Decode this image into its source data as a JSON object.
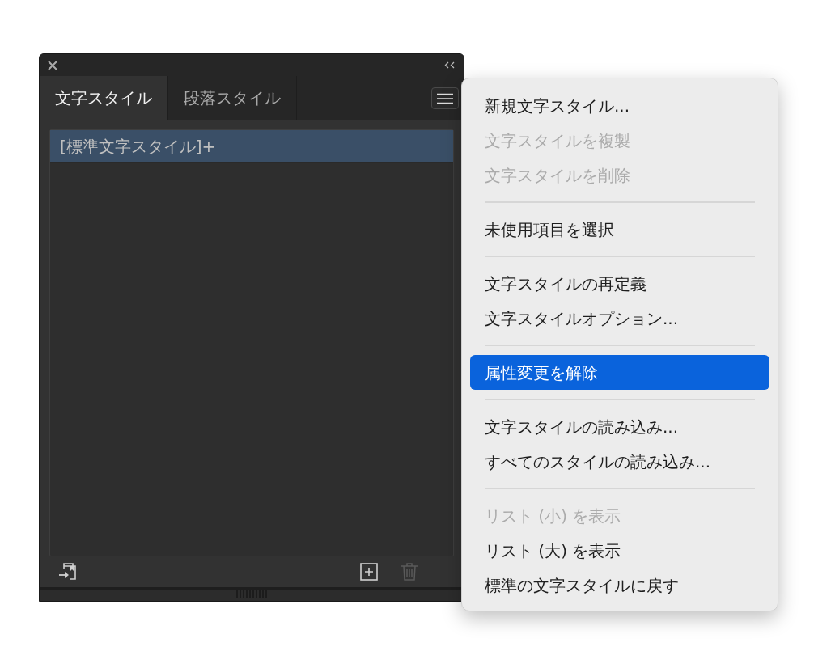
{
  "panel": {
    "tabs": [
      {
        "label": "文字スタイル",
        "selected": true
      },
      {
        "label": "段落スタイル",
        "selected": false
      }
    ],
    "styles": [
      {
        "label": "[標準文字スタイル]+",
        "selected": true
      }
    ],
    "footer_buttons": [
      {
        "kind": "load",
        "disabled": false
      },
      {
        "kind": "new",
        "disabled": false
      },
      {
        "kind": "delete",
        "disabled": true
      }
    ]
  },
  "menu": {
    "items": [
      {
        "kind": "item",
        "label": "新規文字スタイル...",
        "disabled": false,
        "selected": false
      },
      {
        "kind": "item",
        "label": "文字スタイルを複製",
        "disabled": true,
        "selected": false
      },
      {
        "kind": "item",
        "label": "文字スタイルを削除",
        "disabled": true,
        "selected": false
      },
      {
        "kind": "separator"
      },
      {
        "kind": "item",
        "label": "未使用項目を選択",
        "disabled": false,
        "selected": false
      },
      {
        "kind": "separator"
      },
      {
        "kind": "item",
        "label": "文字スタイルの再定義",
        "disabled": false,
        "selected": false
      },
      {
        "kind": "item",
        "label": "文字スタイルオプション...",
        "disabled": false,
        "selected": false
      },
      {
        "kind": "separator"
      },
      {
        "kind": "item",
        "label": "属性変更を解除",
        "disabled": false,
        "selected": true
      },
      {
        "kind": "separator"
      },
      {
        "kind": "item",
        "label": "文字スタイルの読み込み...",
        "disabled": false,
        "selected": false
      },
      {
        "kind": "item",
        "label": "すべてのスタイルの読み込み...",
        "disabled": false,
        "selected": false
      },
      {
        "kind": "separator"
      },
      {
        "kind": "item",
        "label": "リスト (小) を表示",
        "disabled": true,
        "selected": false
      },
      {
        "kind": "item",
        "label": "リスト (大) を表示",
        "disabled": false,
        "selected": false
      },
      {
        "kind": "item",
        "label": "標準の文字スタイルに戻す",
        "disabled": false,
        "selected": false
      }
    ]
  }
}
